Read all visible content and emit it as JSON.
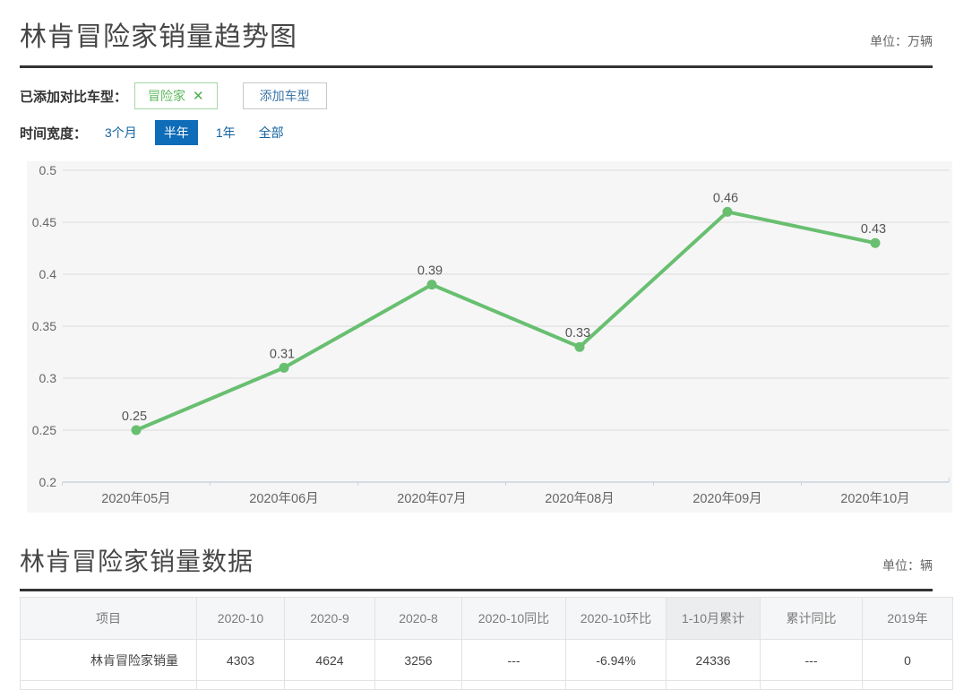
{
  "section_trend": {
    "title": "林肯冒险家销量趋势图",
    "unit": "单位：万辆",
    "compare_label": "已添加对比车型：",
    "tag": {
      "label": "冒险家",
      "remove_icon": "✕"
    },
    "add_button": "添加车型",
    "time_label": "时间宽度：",
    "time_options": [
      {
        "label": "3个月"
      },
      {
        "label": "半年"
      },
      {
        "label": "1年"
      },
      {
        "label": "全部"
      }
    ],
    "selected_time_option": "半年"
  },
  "chart_data": {
    "type": "line",
    "title": "林肯冒险家销量趋势图",
    "categories": [
      "2020年05月",
      "2020年06月",
      "2020年07月",
      "2020年08月",
      "2020年09月",
      "2020年10月"
    ],
    "values": [
      0.25,
      0.31,
      0.39,
      0.33,
      0.46,
      0.43
    ],
    "ylim": [
      0.2,
      0.5
    ],
    "yticks": [
      0.2,
      0.25,
      0.3,
      0.35,
      0.4,
      0.45,
      0.5
    ],
    "unit": "万辆",
    "grid": true,
    "legend": "none",
    "line_color": "#68bf70",
    "grid_color": "#dcdcdc",
    "axis_color": "#c9d3dd",
    "label_color": "#666666",
    "chart_bg": "#f6f6f7"
  },
  "section_table": {
    "title": "林肯冒险家销量数据",
    "unit": "单位：辆",
    "headers": [
      "项目",
      "2020-10",
      "2020-9",
      "2020-8",
      "2020-10同比",
      "2020-10环比",
      "1-10月累计",
      "累计同比",
      "2019年"
    ],
    "rows": [
      [
        "林肯冒险家销量",
        "4303",
        "4624",
        "3256",
        "---",
        "-6.94%",
        "24336",
        "---",
        "0"
      ]
    ]
  }
}
